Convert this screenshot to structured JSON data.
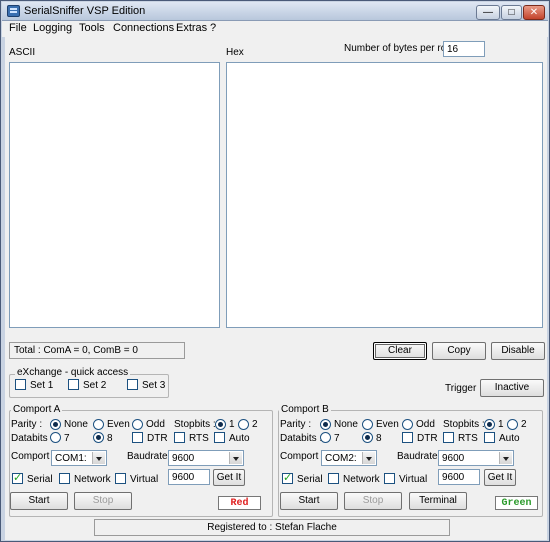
{
  "window": {
    "title": "SerialSniffer VSP Edition",
    "minimize": "—",
    "maximize": "□",
    "close": "✕"
  },
  "menu": [
    "File",
    "Logging",
    "Tools",
    "Connections",
    "Extras",
    "?"
  ],
  "monitor": {
    "ascii_label": "ASCII",
    "hex_label": "Hex",
    "bytes_per_row_label": "Number of bytes per row :",
    "bytes_per_row_value": "16",
    "total": "Total : ComA = 0, ComB = 0",
    "clear": "Clear",
    "copy": "Copy",
    "disable": "Disable"
  },
  "exchange": {
    "title": "eXchange - quick access",
    "set1": "Set 1",
    "set2": "Set 2",
    "set3": "Set 3"
  },
  "trigger": {
    "label": "Trigger :",
    "button": "Inactive"
  },
  "comport_a": {
    "title": "Comport A",
    "parity_label": "Parity :",
    "parity_none": "None",
    "parity_even": "Even",
    "parity_odd": "Odd",
    "stopbits_label": "Stopbits :",
    "stop1": "1",
    "stop2": "2",
    "databits_label": "Databits :",
    "data7": "7",
    "data8": "8",
    "dtr": "DTR",
    "rts": "RTS",
    "auto": "Auto",
    "comport_label": "Comport :",
    "comport_value": "COM1:",
    "baudrate_label": "Baudrate :",
    "baudrate_value": "9600",
    "baud_input": "9600",
    "getit": "Get It",
    "serial": "Serial",
    "network": "Network",
    "virtual": "Virtual",
    "start": "Start",
    "stop": "Stop",
    "lamp": "Red",
    "lamp_color": "#e02020"
  },
  "comport_b": {
    "title": "Comport B",
    "parity_label": "Parity :",
    "parity_none": "None",
    "parity_even": "Even",
    "parity_odd": "Odd",
    "stopbits_label": "Stopbits :",
    "stop1": "1",
    "stop2": "2",
    "databits_label": "Databits :",
    "data7": "7",
    "data8": "8",
    "dtr": "DTR",
    "rts": "RTS",
    "auto": "Auto",
    "comport_label": "Comport :",
    "comport_value": "COM2:",
    "baudrate_label": "Baudrate :",
    "baudrate_value": "9600",
    "baud_input": "9600",
    "getit": "Get It",
    "serial": "Serial",
    "network": "Network",
    "virtual": "Virtual",
    "start": "Start",
    "stop": "Stop",
    "terminal": "Terminal",
    "lamp": "Green",
    "lamp_color": "#2a9a2a"
  },
  "statusbar": {
    "registered": "Registered to : Stefan Flache"
  }
}
